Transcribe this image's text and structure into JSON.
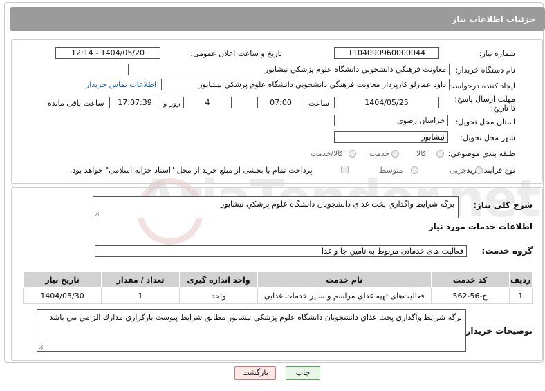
{
  "header": {
    "title": "جزئیات اطلاعات نیاز"
  },
  "watermark": {
    "text": "AriaTender.net"
  },
  "form": {
    "need_number_label": "شماره نیاز:",
    "need_number": "1104090960000044",
    "announce_label": "تاریخ و ساعت اعلان عمومی:",
    "announce_value": "1404/05/20 - 12:14",
    "buyer_label": "نام دستگاه خریدار:",
    "buyer_value": "معاونت فرهنگي دانشجويي دانشگاه علوم پزشكي نيشابور",
    "creator_label": "ایجاد کننده درخواست:",
    "creator_value": "داود عمارلو كارپرداز معاونت فرهنگي دانشجويي دانشگاه علوم پزشكي نيشابور",
    "contact_link": "اطلاعات تماس خریدار",
    "deadline_label": "مهلت ارسال پاسخ: تا تاریخ:",
    "deadline_date": "1404/05/25",
    "time_label": "ساعت",
    "deadline_time": "07:00",
    "days_value": "4",
    "days_label": "روز و",
    "remaining_time": "17:07:39",
    "remaining_label": "ساعت باقی مانده",
    "province_label": "استان محل تحویل:",
    "province_value": "خراسان رضوی",
    "city_label": "شهر محل تحویل:",
    "city_value": "نيشابور",
    "category_label": "طبقه بندی موضوعی:",
    "category_options": [
      "کالا",
      "خدمت",
      "کالا/خدمت"
    ],
    "process_label": "نوع فرآیند خرید :",
    "process_options": [
      "جزیی",
      "متوسط"
    ],
    "payment_note": "پرداخت تمام یا بخشی از مبلغ خرید،از محل \"اسناد خزانه اسلامی\" خواهد بود."
  },
  "details": {
    "summary_label": "شرح کلی نیاز:",
    "summary_value": "برگه شرايط واگذاري پخت غذاي دانشجويان دانشگاه علوم پزشكي نيشابور",
    "services_heading": "اطلاعات خدمات مورد نیاز",
    "group_label": "گروه خدمت:",
    "group_value": "فعالیت های خدماتی مربوط به تامین جا و غذا",
    "table": {
      "headers": [
        "ردیف",
        "کد خدمت",
        "نام خدمت",
        "واحد اندازه گیری",
        "تعداد / مقدار",
        "تاریخ نیاز"
      ],
      "rows": [
        [
          "1",
          "خ-56-562",
          "فعالیت‌های تهیه غذای مراسم و سایر خدمات غذایی",
          "واحد",
          "1",
          "1404/05/30"
        ]
      ]
    },
    "notes_label": "توضیحات خریدار:",
    "notes_value": "برگه شرايط واگذاري پخت غذاي دانشجويان دانشگاه علوم پزشكي نيشابور مطابق شرايط پيوست بارگزاري مدارك الزامي مي باشد"
  },
  "buttons": {
    "print": "چاپ",
    "back": "بازگشت"
  }
}
